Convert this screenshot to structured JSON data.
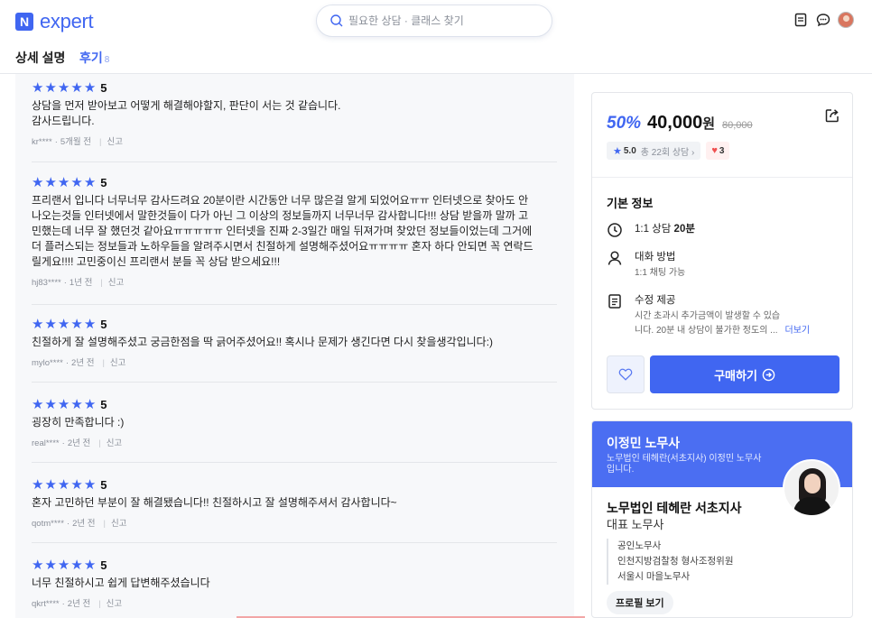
{
  "header": {
    "logo_mark": "N",
    "logo_text": "expert",
    "search_placeholder": "필요한 상담 · 클래스 찾기",
    "icons": [
      "notebook-icon",
      "chat-icon",
      "profile-avatar"
    ]
  },
  "tabs": [
    {
      "label": "상세 설명"
    },
    {
      "label": "후기",
      "count": "8"
    }
  ],
  "reviews": [
    {
      "score": "5",
      "text": "상담을 먼저 받아보고 어떻게 해결해야할지, 판단이 서는 것 같습니다.\n감사드립니다.",
      "user": "kr****",
      "time": "5개월 전",
      "report": "신고"
    },
    {
      "score": "5",
      "text": "프리랜서 입니다 너무너무 감사드려요 20분이란 시간동안 너무 많은걸 알게 되었어요ㅠㅠ 인터넷으로 찾아도 안\n나오는것들 인터넷에서 말한것들이 다가 아닌 그 이상의 정보들까지 너무너무 감사합니다!!! 상담 받을까 말까 고\n민했는데 너무 잘 했던것 같아요ㅠㅠㅠㅠㅠ 인터넷을 진짜 2-3일간 매일 뒤져가며 찾았던 정보들이었는데 그거에\n더 플러스되는 정보들과 노하우들을 알려주시면서 친절하게 설명해주셨어요ㅠㅠㅠㅠ 혼자 하다 안되면 꼭 연락드\n릴게요!!!! 고민중이신 프리랜서 분들 꼭 상담 받으세요!!!",
      "user": "hj83****",
      "time": "1년 전",
      "report": "신고"
    },
    {
      "score": "5",
      "text": "친절하게 잘 설명해주셨고 궁금한점을 딱 긁어주셨어요!! 혹시나 문제가 생긴다면 다시 찾을생각입니다:)",
      "user": "mylo****",
      "time": "2년 전",
      "report": "신고"
    },
    {
      "score": "5",
      "text": "굉장히 만족합니다 :)",
      "user": "real****",
      "time": "2년 전",
      "report": "신고"
    },
    {
      "score": "5",
      "text": "혼자 고민하던 부분이 잘 해결됐습니다!! 친절하시고 잘 설명해주셔서 감사합니다~",
      "user": "qotm****",
      "time": "2년 전",
      "report": "신고"
    },
    {
      "score": "5",
      "text": "너무 친절하시고 쉽게 답변해주셨습니다",
      "user": "qkrt****",
      "time": "2년 전",
      "report": "신고"
    }
  ],
  "product": {
    "discount": "50%",
    "price": "40,000",
    "currency": "원",
    "original_price": "80,000",
    "rating": "5.0",
    "consult_count": "총 22회 상담 ›",
    "likes": "3",
    "info_title": "기본 정보",
    "duration_prefix": "1:1 상담",
    "duration_value": "20분",
    "method_title": "대화 방법",
    "method_value": "1:1 채팅 가능",
    "revision_title": "수정 제공",
    "revision_line1": "시간 초과시 추가금액이 발생할 수 있습",
    "revision_line2": "니다. 20분 내 상담이 불가한 정도의 ...",
    "more_label": "더보기",
    "buy_label": "구매하기",
    "accent_color": "#4066f1"
  },
  "expert": {
    "name": "이정민 노무사",
    "desc": "노무법인 테헤란(서초지사) 이정민 노무사입니다.",
    "office": "노무법인 테헤란 서초지사",
    "role": "대표 노무사",
    "credentials": [
      "공인노무사",
      "인천지방검찰청 형사조정위원",
      "서울시 마을노무사"
    ],
    "profile_button": "프로필 보기"
  }
}
